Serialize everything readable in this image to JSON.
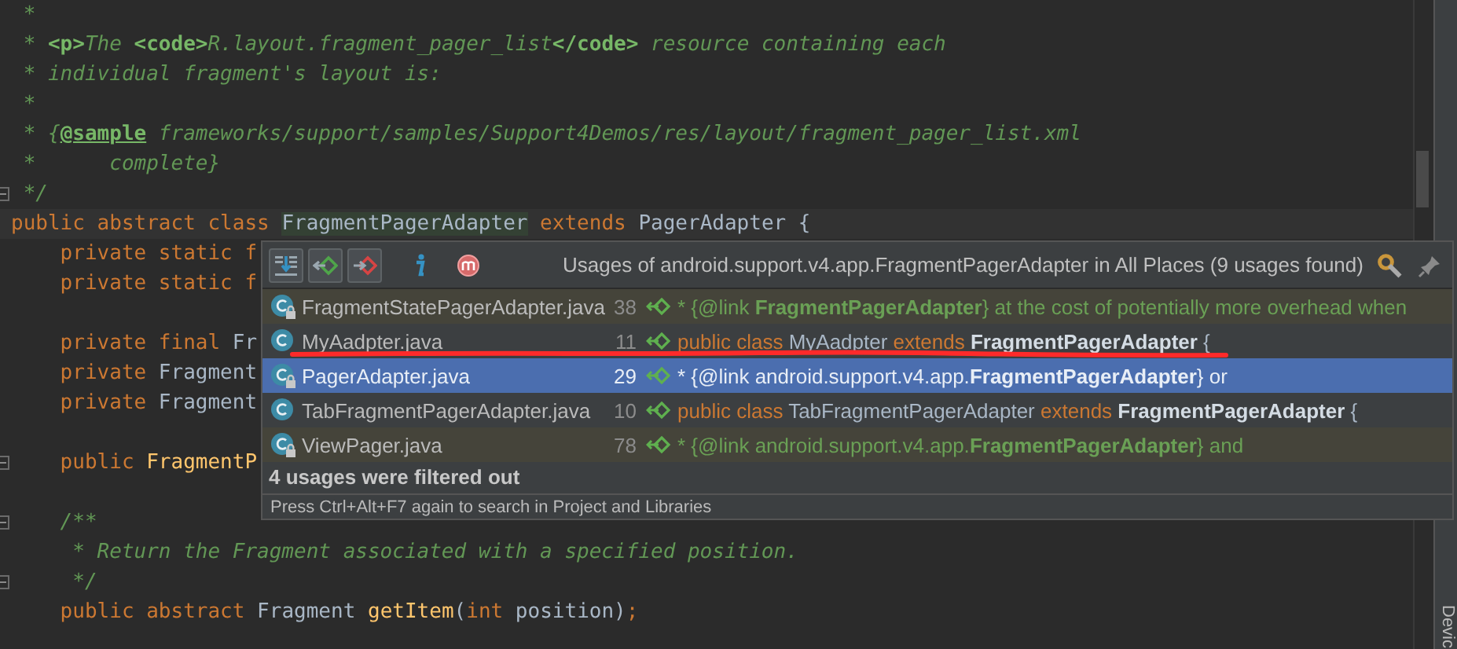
{
  "editor": {
    "lines": [
      {
        "kind": "code",
        "segments": [
          {
            "text": " *",
            "kind": "comment"
          }
        ]
      },
      {
        "kind": "code",
        "segments": [
          {
            "text": " * ",
            "kind": "comment"
          },
          {
            "text": "<p>",
            "kind": "tag"
          },
          {
            "text": "The ",
            "kind": "comment"
          },
          {
            "text": "<code>",
            "kind": "tag"
          },
          {
            "text": "R.layout.fragment_pager_list",
            "kind": "comment"
          },
          {
            "text": "</code>",
            "kind": "tag"
          },
          {
            "text": " resource containing each",
            "kind": "comment"
          }
        ]
      },
      {
        "kind": "code",
        "segments": [
          {
            "text": " * individual fragment's layout is:",
            "kind": "comment"
          }
        ]
      },
      {
        "kind": "code",
        "segments": [
          {
            "text": " *",
            "kind": "comment"
          }
        ]
      },
      {
        "kind": "code",
        "segments": [
          {
            "text": " * {",
            "kind": "comment"
          },
          {
            "text": "@sample",
            "kind": "doctag"
          },
          {
            "text": " frameworks/support/samples/Support4Demos/res/layout/fragment_pager_list.xml",
            "kind": "comment"
          }
        ]
      },
      {
        "kind": "code",
        "segments": [
          {
            "text": " *      complete}",
            "kind": "comment"
          }
        ]
      },
      {
        "kind": "code",
        "fold": true,
        "segments": [
          {
            "text": " */",
            "kind": "comment"
          }
        ]
      },
      {
        "kind": "code",
        "current": true,
        "segments": [
          {
            "text": "public abstract class ",
            "kind": "keyword"
          },
          {
            "text": "FragmentPagerAdapter",
            "kind": "highlight"
          },
          {
            "text": " extends ",
            "kind": "keyword"
          },
          {
            "text": "PagerAdapter {",
            "kind": "plain"
          }
        ]
      },
      {
        "kind": "code",
        "segments": [
          {
            "text": "    private static f",
            "kind": "keyword"
          }
        ]
      },
      {
        "kind": "code",
        "segments": [
          {
            "text": "    private static f",
            "kind": "keyword"
          }
        ]
      },
      {
        "kind": "blank"
      },
      {
        "kind": "code",
        "segments": [
          {
            "text": "    private final ",
            "kind": "keyword"
          },
          {
            "text": "Fr",
            "kind": "plain"
          }
        ]
      },
      {
        "kind": "code",
        "segments": [
          {
            "text": "    private ",
            "kind": "keyword"
          },
          {
            "text": "Fragment",
            "kind": "plain"
          }
        ]
      },
      {
        "kind": "code",
        "segments": [
          {
            "text": "    private ",
            "kind": "keyword"
          },
          {
            "text": "Fragment",
            "kind": "plain"
          }
        ]
      },
      {
        "kind": "blank"
      },
      {
        "kind": "code",
        "fold": true,
        "segments": [
          {
            "text": "    public ",
            "kind": "keyword"
          },
          {
            "text": "FragmentP",
            "kind": "method"
          }
        ]
      },
      {
        "kind": "blank"
      },
      {
        "kind": "code",
        "fold": true,
        "segments": [
          {
            "text": "    /**",
            "kind": "comment"
          }
        ]
      },
      {
        "kind": "code",
        "segments": [
          {
            "text": "     * Return the Fragment associated with a specified position.",
            "kind": "comment"
          }
        ]
      },
      {
        "kind": "code",
        "fold": true,
        "segments": [
          {
            "text": "     */",
            "kind": "comment"
          }
        ]
      },
      {
        "kind": "code",
        "segments": [
          {
            "text": "    public abstract ",
            "kind": "keyword"
          },
          {
            "text": "Fragment ",
            "kind": "plain"
          },
          {
            "text": "getItem",
            "kind": "method"
          },
          {
            "text": "(",
            "kind": "plain"
          },
          {
            "text": "int",
            "kind": "keyword"
          },
          {
            "text": " position)",
            "kind": "plain"
          },
          {
            "text": ";",
            "kind": "keyword"
          }
        ]
      }
    ]
  },
  "side_tab": "Devic",
  "usages_popup": {
    "title": "Usages of android.support.v4.app.FragmentPagerAdapter in All Places (9 usages found)",
    "toolbar": [
      {
        "kind": "merge",
        "on": true
      },
      {
        "kind": "prev",
        "on": true
      },
      {
        "kind": "next",
        "on": true
      },
      {
        "kind": "info",
        "on": false
      },
      {
        "kind": "module",
        "on": false
      }
    ],
    "rows": [
      {
        "file": "FragmentStatePagerAdapter.java",
        "line": "38",
        "library": true,
        "selected": false,
        "annotated": false,
        "segments": [
          {
            "text": "* {@link ",
            "kind": "comment"
          },
          {
            "text": "FragmentPagerAdapter",
            "kind": "comment-bold"
          },
          {
            "text": "} at the cost of potentially more overhead when",
            "kind": "comment"
          }
        ]
      },
      {
        "file": "MyAadpter.java",
        "line": "11",
        "library": false,
        "selected": false,
        "annotated": true,
        "segments": [
          {
            "text": "public class ",
            "kind": "keyword"
          },
          {
            "text": "MyAadpter ",
            "kind": "plain"
          },
          {
            "text": "extends ",
            "kind": "keyword"
          },
          {
            "text": "FragmentPagerAdapter",
            "kind": "bold"
          },
          {
            "text": " {",
            "kind": "plain"
          }
        ]
      },
      {
        "file": "PagerAdapter.java",
        "line": "29",
        "library": true,
        "selected": true,
        "annotated": false,
        "segments": [
          {
            "text": "* {@link android.support.v4.app.",
            "kind": "comment"
          },
          {
            "text": "FragmentPagerAdapter",
            "kind": "comment-bold"
          },
          {
            "text": "} or",
            "kind": "comment"
          }
        ]
      },
      {
        "file": "TabFragmentPagerAdapter.java",
        "line": "10",
        "library": false,
        "selected": false,
        "annotated": false,
        "segments": [
          {
            "text": "public class ",
            "kind": "keyword"
          },
          {
            "text": "TabFragmentPagerAdapter ",
            "kind": "plain"
          },
          {
            "text": "extends ",
            "kind": "keyword"
          },
          {
            "text": "FragmentPagerAdapter",
            "kind": "bold"
          },
          {
            "text": " {",
            "kind": "plain"
          }
        ]
      },
      {
        "file": "ViewPager.java",
        "line": "78",
        "library": true,
        "selected": false,
        "annotated": false,
        "segments": [
          {
            "text": "* {@link android.support.v4.app.",
            "kind": "comment"
          },
          {
            "text": "FragmentPagerAdapter",
            "kind": "comment-bold"
          },
          {
            "text": "} and",
            "kind": "comment"
          }
        ]
      }
    ],
    "filtered_note": "4 usages were filtered out",
    "footer": "Press Ctrl+Alt+F7 again to search in Project and Libraries"
  }
}
